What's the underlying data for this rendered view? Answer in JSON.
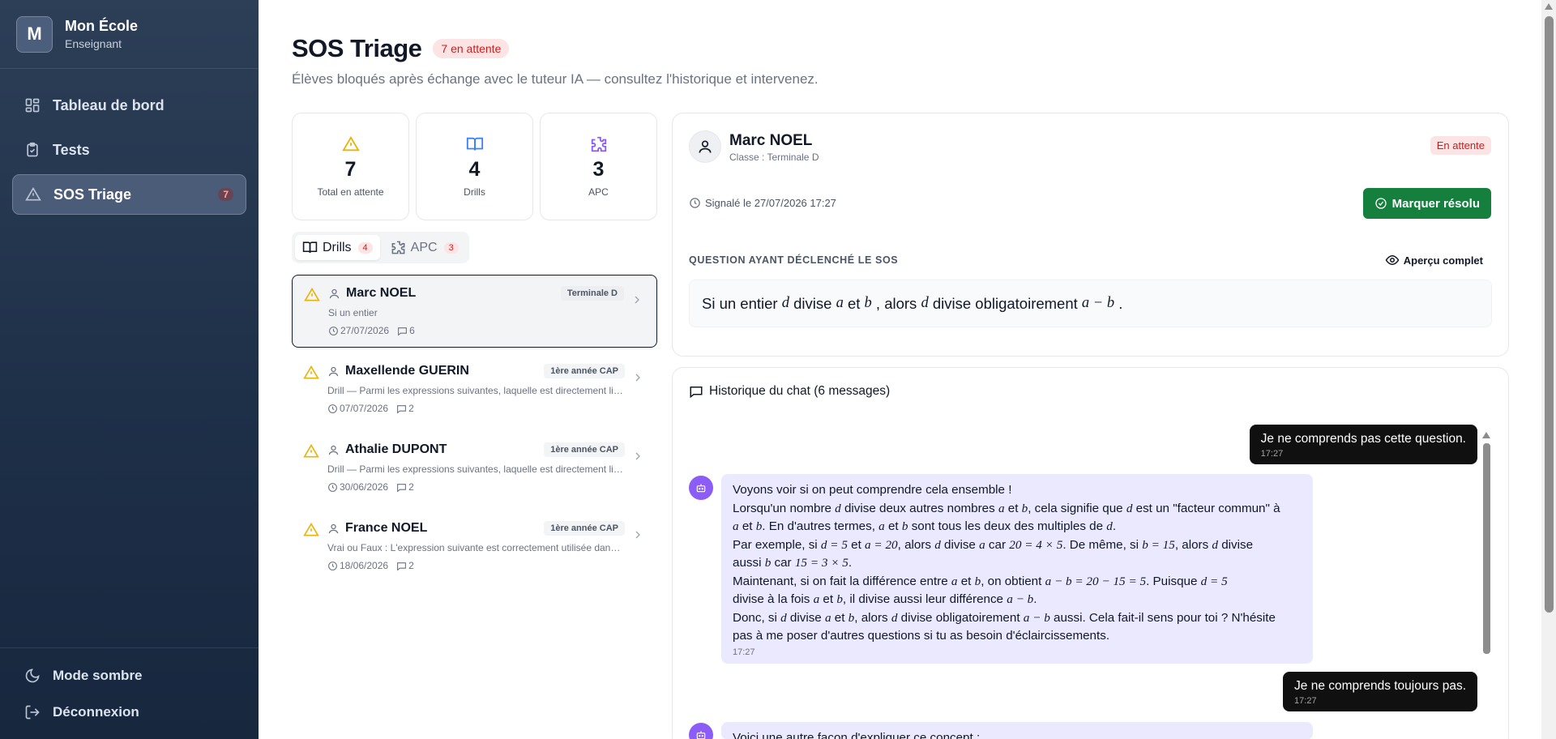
{
  "brand": {
    "initial": "M",
    "name": "Mon École",
    "role": "Enseignant"
  },
  "nav": [
    {
      "label": "Tableau de bord",
      "icon": "dashboard-icon"
    },
    {
      "label": "Tests",
      "icon": "clipboard-icon"
    },
    {
      "label": "SOS Triage",
      "icon": "warning-icon",
      "badge": "7"
    }
  ],
  "sidebar_bottom": {
    "dark_mode": "Mode sombre",
    "logout": "Déconnexion"
  },
  "header": {
    "title": "SOS Triage",
    "pending_badge": "7 en attente",
    "subtitle": "Élèves bloqués après échange avec le tuteur IA — consultez l'historique et intervenez."
  },
  "stats": [
    {
      "value": "7",
      "label": "Total en attente",
      "icon": "warning-icon",
      "color": "#eab308"
    },
    {
      "value": "4",
      "label": "Drills",
      "icon": "book-icon",
      "color": "#3b82f6"
    },
    {
      "value": "3",
      "label": "APC",
      "icon": "puzzle-icon",
      "color": "#8b5cf6"
    }
  ],
  "tabs": [
    {
      "label": "Drills",
      "count": "4"
    },
    {
      "label": "APC",
      "count": "3"
    }
  ],
  "items": [
    {
      "name": "Marc NOEL",
      "class": "Terminale D",
      "preview": "Si un entier",
      "date": "27/07/2026",
      "messages": "6"
    },
    {
      "name": "Maxellende GUERIN",
      "class": "1ère année CAP",
      "preview": "Drill — Parmi les expressions suivantes, laquelle est directement liée au concept de…",
      "date": "07/07/2026",
      "messages": "2"
    },
    {
      "name": "Athalie DUPONT",
      "class": "1ère année CAP",
      "preview": "Drill — Parmi les expressions suivantes, laquelle est directement liée au concept de…",
      "date": "30/06/2026",
      "messages": "2"
    },
    {
      "name": "France NOEL",
      "class": "1ère année CAP",
      "preview": "Vrai ou Faux : L'expression suivante est correctement utilisée dans ce contexte…",
      "date": "18/06/2026",
      "messages": "2"
    }
  ],
  "detail": {
    "name": "Marc NOEL",
    "class_line": "Classe : Terminale D",
    "status": "En attente",
    "signaled": "Signalé le 27/07/2026 17:27",
    "resolve_label": "Marquer résolu",
    "question_label": "QUESTION AYANT DÉCLENCHÉ LE SOS",
    "preview_label": "Aperçu complet",
    "question": {
      "t1": "Si un entier ",
      "m1": "d",
      "t2": " divise ",
      "m2": "a",
      "t3": " et ",
      "m3": "b",
      "t4": " , alors ",
      "m4": "d",
      "t5": " divise obligatoirement ",
      "m5": "a − b",
      "t6": " ."
    }
  },
  "chat": {
    "header": "Historique du chat (6 messages)",
    "msg1": {
      "text": "Je ne comprends pas cette question.",
      "time": "17:27"
    },
    "msg2": {
      "l1": "Voyons voir si on peut comprendre cela ensemble !",
      "l2a": "Lorsqu'un nombre ",
      "l2m1": "d",
      "l2b": " divise deux autres nombres ",
      "l2m2": "a",
      "l2c": " et ",
      "l2m3": "b",
      "l2d": ", cela signifie que ",
      "l2m4": "d",
      "l2e": " est un \"facteur commun\" à",
      "l3m1": "a",
      "l3a": " et ",
      "l3m2": "b",
      "l3b": ". En d'autres termes, ",
      "l3m3": "a",
      "l3c": " et ",
      "l3m4": "b",
      "l3d": " sont tous les deux des multiples de ",
      "l3m5": "d",
      "l3e": ".",
      "l4a": "Par exemple, si ",
      "l4m1": "d = 5",
      "l4b": " et ",
      "l4m2": "a = 20",
      "l4c": ", alors ",
      "l4m3": "d",
      "l4d": " divise ",
      "l4m4": "a",
      "l4e": " car ",
      "l4m5": "20 = 4 × 5",
      "l4f": ". De même, si ",
      "l4m6": "b = 15",
      "l4g": ", alors ",
      "l4m7": "d",
      "l4h": " divise",
      "l5a": "aussi ",
      "l5m1": "b",
      "l5b": " car ",
      "l5m2": "15 = 3 × 5",
      "l5c": ".",
      "l6a": "Maintenant, si on fait la différence entre ",
      "l6m1": "a",
      "l6b": " et ",
      "l6m2": "b",
      "l6c": ", on obtient ",
      "l6m3": "a − b = 20 − 15 = 5",
      "l6d": ". Puisque ",
      "l6m4": "d = 5",
      "l7a": "divise à la fois ",
      "l7m1": "a",
      "l7b": " et ",
      "l7m2": "b",
      "l7c": ", il divise aussi leur différence ",
      "l7m3": "a − b",
      "l7d": ".",
      "l8a": "Donc, si ",
      "l8m1": "d",
      "l8b": " divise ",
      "l8m2": "a",
      "l8c": " et ",
      "l8m3": "b",
      "l8d": ", alors ",
      "l8m4": "d",
      "l8e": " divise obligatoirement ",
      "l8m5": "a − b",
      "l8f": " aussi. Cela fait-il sens pour toi ? N'hésite",
      "l9": "pas à me poser d'autres questions si tu as besoin d'éclaircissements.",
      "time": "17:27"
    },
    "msg3": {
      "text": "Je ne comprends toujours pas.",
      "time": "17:27"
    },
    "msg4": {
      "text": "Voici une autre façon d'expliquer ce concept :"
    }
  }
}
